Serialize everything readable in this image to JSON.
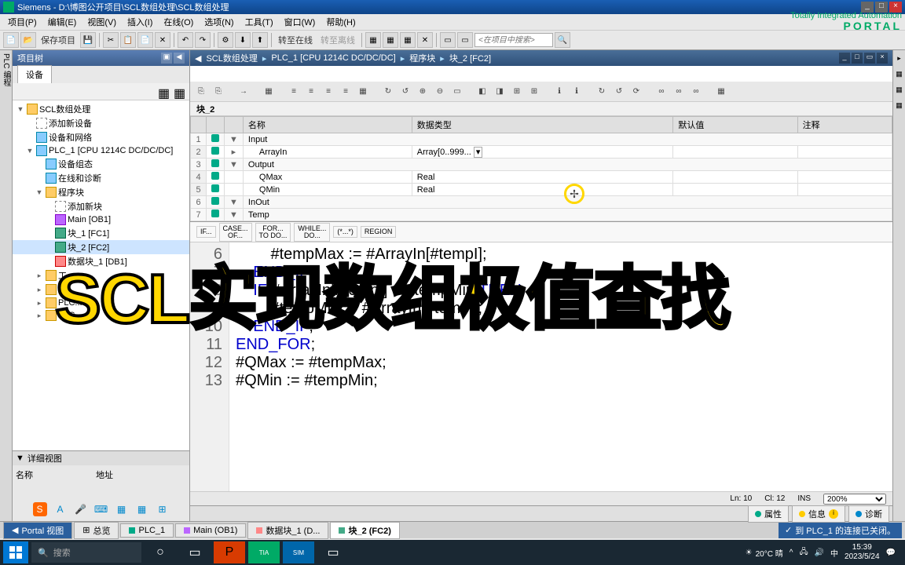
{
  "titlebar": {
    "app": "Siemens",
    "path": "D:\\博图公开项目\\SCL数组处理\\SCL数组处理"
  },
  "menu": {
    "items": [
      "项目(P)",
      "编辑(E)",
      "视图(V)",
      "插入(I)",
      "在线(O)",
      "选项(N)",
      "工具(T)",
      "窗口(W)",
      "帮助(H)"
    ],
    "brand1": "Totally Integrated Automation",
    "brand2": "PORTAL"
  },
  "toolbar": {
    "save": "保存项目",
    "online": "转至在线",
    "offline": "转至离线",
    "search_placeholder": "<在项目中搜索>"
  },
  "project_tree": {
    "title": "项目树",
    "tab": "设备",
    "items": [
      {
        "level": 0,
        "exp": "▼",
        "icon": "folder",
        "label": "SCL数组处理"
      },
      {
        "level": 1,
        "exp": "",
        "icon": "add",
        "label": "添加新设备"
      },
      {
        "level": 1,
        "exp": "",
        "icon": "device",
        "label": "设备和网络"
      },
      {
        "level": 1,
        "exp": "▼",
        "icon": "device",
        "label": "PLC_1 [CPU 1214C DC/DC/DC]"
      },
      {
        "level": 2,
        "exp": "",
        "icon": "device",
        "label": "设备组态"
      },
      {
        "level": 2,
        "exp": "",
        "icon": "device",
        "label": "在线和诊断"
      },
      {
        "level": 2,
        "exp": "▼",
        "icon": "folder",
        "label": "程序块"
      },
      {
        "level": 3,
        "exp": "",
        "icon": "add",
        "label": "添加新块"
      },
      {
        "level": 3,
        "exp": "",
        "icon": "ob",
        "label": "Main [OB1]"
      },
      {
        "level": 3,
        "exp": "",
        "icon": "block",
        "label": "块_1 [FC1]"
      },
      {
        "level": 3,
        "exp": "",
        "icon": "block",
        "label": "块_2 [FC2]",
        "selected": true
      },
      {
        "level": 3,
        "exp": "",
        "icon": "db",
        "label": "数据块_1 [DB1]"
      },
      {
        "level": 2,
        "exp": "▸",
        "icon": "folder",
        "label": "工..."
      },
      {
        "level": 2,
        "exp": "▸",
        "icon": "folder",
        "label": "外..."
      },
      {
        "level": 2,
        "exp": "▸",
        "icon": "folder",
        "label": "PLC..."
      },
      {
        "level": 2,
        "exp": "▸",
        "icon": "folder",
        "label": "PLC..."
      }
    ]
  },
  "detail": {
    "title": "详细视图",
    "col1": "名称",
    "col2": "地址"
  },
  "breadcrumb": {
    "parts": [
      "SCL数组处理",
      "PLC_1 [CPU 1214C DC/DC/DC]",
      "程序块",
      "块_2 [FC2]"
    ]
  },
  "block": {
    "name": "块_2"
  },
  "vartable": {
    "headers": [
      "",
      "",
      "",
      "名称",
      "数据类型",
      "默认值",
      "注释"
    ],
    "rows": [
      {
        "n": "1",
        "section": "Input",
        "exp": "▼"
      },
      {
        "n": "2",
        "name": "ArrayIn",
        "type": "Array[0..999...",
        "exp": "▸"
      },
      {
        "n": "3",
        "section": "Output",
        "exp": "▼"
      },
      {
        "n": "4",
        "name": "QMax",
        "type": "Real"
      },
      {
        "n": "5",
        "name": "QMin",
        "type": "Real"
      },
      {
        "n": "6",
        "section": "InOut",
        "exp": "▼"
      },
      {
        "n": "7",
        "section": "Temp",
        "exp": "▼"
      }
    ]
  },
  "snippets": [
    "IF...",
    "CASE...\nOF...",
    "FOR...\nTO DO...",
    "WHILE...\nDO...",
    "(*...*)",
    "REGION"
  ],
  "code": {
    "lines": [
      {
        "n": "6",
        "text": "        #tempMax := #ArrayIn[#tempI];"
      },
      {
        "n": "7",
        "text": "    END_IF;"
      },
      {
        "n": "8",
        "text": "    IF #ArrayIn[#tempI] < #tempMin THEN"
      },
      {
        "n": "9",
        "text": "        #tempMin := #ArrayIn[#tempI];"
      },
      {
        "n": "10",
        "text": "    END_IF;"
      },
      {
        "n": "11",
        "text": "END_FOR;"
      },
      {
        "n": "12",
        "text": "#QMax := #tempMax;"
      },
      {
        "n": "13",
        "text": "#QMin := #tempMin;"
      }
    ]
  },
  "status": {
    "ln": "Ln: 10",
    "cl": "Cl: 12",
    "ins": "INS",
    "zoom": "200%"
  },
  "footer": {
    "props": "属性",
    "info": "信息",
    "diag": "诊断"
  },
  "doctabs": {
    "portal": "Portal 视图",
    "overview": "总览",
    "tabs": [
      "PLC_1",
      "Main (OB1)",
      "数据块_1 (D...",
      "块_2 (FC2)"
    ],
    "status": "到 PLC_1 的连接已关闭。"
  },
  "taskbar": {
    "search": "搜索",
    "weather": "20°C 晴",
    "time": "15:39",
    "date": "2023/5/24"
  },
  "overlay": "SCL实现数组极值查找"
}
